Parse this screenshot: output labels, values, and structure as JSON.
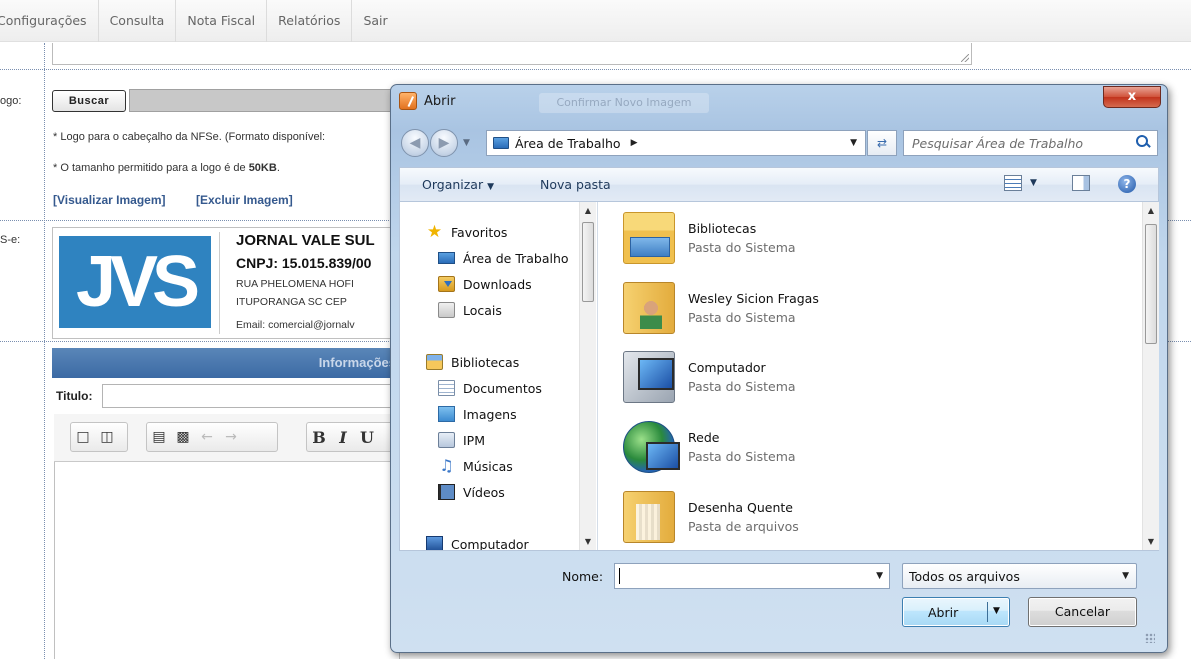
{
  "menu": {
    "items": [
      "Configurações",
      "Consulta",
      "Nota Fiscal",
      "Relatórios",
      "Sair"
    ]
  },
  "form": {
    "logo_label": "ogo:",
    "buscar_label": "Buscar",
    "note_format": "* Logo para o cabeçalho da NFSe. (Formato disponível:",
    "note_size_prefix": "* O tamanho permitido para a logo é de ",
    "note_size_value": "50KB",
    "note_size_suffix": ".",
    "link_view": "[Visualizar Imagem]",
    "link_delete": "[Excluir Imagem]",
    "preview_label": "S-e:",
    "logo_text": "JVS",
    "company_name": "JORNAL VALE SUL",
    "cnpj": "CNPJ: 15.015.839/00",
    "address_line1": "RUA PHELOMENA HOFI",
    "address_line2": "ITUPORANGA SC   CEP",
    "email_line": "Email: comercial@jornalv",
    "info_bar_title": "Informações",
    "titulo_label": "Titulo:",
    "toolbar_icons": [
      "new-doc-icon",
      "preview-icon",
      "paste-icon",
      "paste-text-icon",
      "undo-icon",
      "redo-icon",
      "bold-icon",
      "italic-icon"
    ]
  },
  "dialog": {
    "title": "Abrir",
    "ghost_title": "Confirmar Novo Imagem",
    "close_label": "x",
    "address_location": "Área de Trabalho",
    "search_placeholder": "Pesquisar Área de Trabalho",
    "command_bar": {
      "organize": "Organizar",
      "new_folder": "Nova pasta"
    },
    "nav_items": [
      {
        "label": "Favoritos",
        "icon": "star-icon"
      },
      {
        "label": "Área de Trabalho",
        "icon": "desktop-icon"
      },
      {
        "label": "Downloads",
        "icon": "downloads-icon"
      },
      {
        "label": "Locais",
        "icon": "recent-places-icon"
      },
      {
        "label": "Bibliotecas",
        "icon": "libraries-icon"
      },
      {
        "label": "Documentos",
        "icon": "documents-icon"
      },
      {
        "label": "Imagens",
        "icon": "pictures-icon"
      },
      {
        "label": "IPM",
        "icon": "ipm-icon"
      },
      {
        "label": "Músicas",
        "icon": "music-icon"
      },
      {
        "label": "Vídeos",
        "icon": "videos-icon"
      },
      {
        "label": "Computador",
        "icon": "computer-icon"
      }
    ],
    "files": [
      {
        "name": "Bibliotecas",
        "type": "Pasta do Sistema",
        "icon": "libraries-folder-icon"
      },
      {
        "name": "Wesley Sicion Fragas",
        "type": "Pasta do Sistema",
        "icon": "user-folder-icon"
      },
      {
        "name": "Computador",
        "type": "Pasta do Sistema",
        "icon": "computer-icon"
      },
      {
        "name": "Rede",
        "type": "Pasta do Sistema",
        "icon": "network-icon"
      },
      {
        "name": "Desenha Quente",
        "type": "Pasta de arquivos",
        "icon": "folder-icon"
      }
    ],
    "filename_label": "Nome:",
    "filename_value": "",
    "filter_value": "Todos os arquivos",
    "open_label": "Abrir",
    "cancel_label": "Cancelar"
  }
}
